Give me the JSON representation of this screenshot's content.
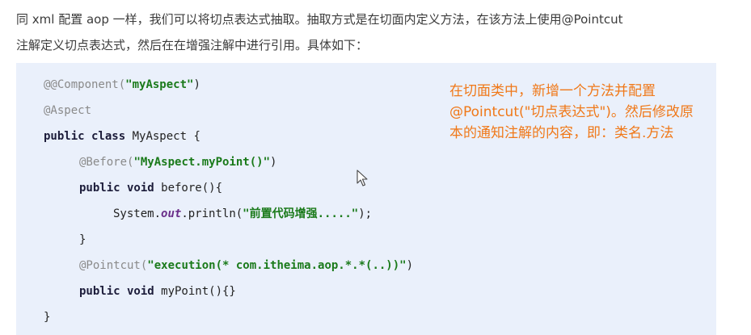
{
  "intro": {
    "line1": "同 xml 配置 aop 一样，我们可以将切点表达式抽取。抽取方式是在切面内定义方法，在该方法上使用@Pointcut",
    "line2": "注解定义切点表达式，然后在在增强注解中进行引用。具体如下："
  },
  "code": {
    "l1": {
      "anno": "@@Component(",
      "str": "\"myAspect\"",
      "end": ")"
    },
    "l2": {
      "anno": "@Aspect"
    },
    "l3": {
      "kw": "public class",
      "rest": " MyAspect {"
    },
    "l4": {
      "anno": "@Before(",
      "str": "\"MyAspect.myPoint()\"",
      "end": ")"
    },
    "l5": {
      "kw": "public void",
      "rest": " before(){"
    },
    "l6": {
      "pre": "System.",
      "field": "out",
      "mid": ".println(",
      "str": "\"前置代码增强.....\"",
      "end": ");"
    },
    "l7": {
      "text": "}"
    },
    "l8": {
      "anno": "@Pointcut(",
      "str": "\"execution(* com.itheima.aop.*.*(..))\"",
      "end": ")"
    },
    "l9": {
      "kw": "public void",
      "rest": " myPoint(){}"
    },
    "l10": {
      "text": "}"
    }
  },
  "note": {
    "line1": "在切面类中，新增一个方法并配置",
    "line2": "@Pointcut(\"切点表达式\")。然后修改原",
    "line3": "本的通知注解的内容，即：类名.方法"
  },
  "colors": {
    "code_bg": "#eaf0fb",
    "note_text": "#f07818",
    "string": "#1a7a1a",
    "annotation": "#8a8a8a"
  },
  "icons": {
    "cursor": "mouse-pointer-icon"
  }
}
